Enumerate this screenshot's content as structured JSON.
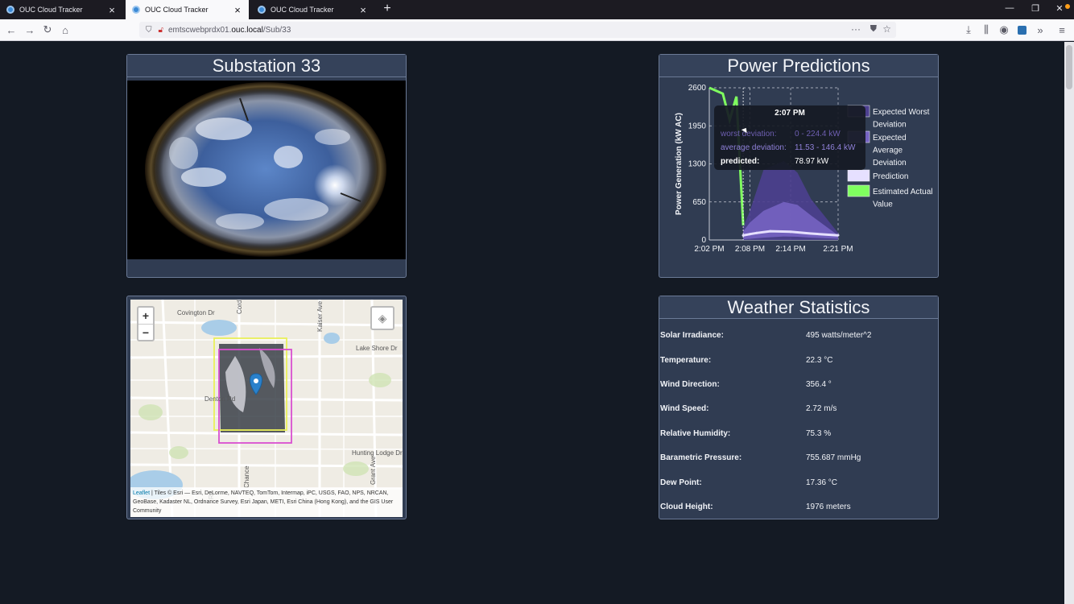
{
  "browser": {
    "tabs": [
      {
        "label": "OUC Cloud Tracker"
      },
      {
        "label": "OUC Cloud Tracker"
      },
      {
        "label": "OUC Cloud Tracker"
      }
    ],
    "url_prefix": "emtscwebprdx01.",
    "url_host": "ouc.local",
    "url_path": "/Sub/33"
  },
  "substation": {
    "title": "Substation 33"
  },
  "map": {
    "zoom_in": "+",
    "zoom_out": "−",
    "streets": [
      "Covington Dr",
      "Cord Ave",
      "Kaiser Ave",
      "Lake Shore Dr",
      "Denton Rd",
      "Hunting Lodge Dr",
      "Chance",
      "Grant Ave",
      "Rd"
    ],
    "attribution_leaflet": "Leaflet",
    "attribution_text": " | Tiles © Esri — Esri, DeLorme, NAVTEQ, TomTom, Intermap, iPC, USGS, FAO, NPS, NRCAN, GeoBase, Kadaster NL, Ordnance Survey, Esri Japan, METI, Esri China (Hong Kong), and the GIS User Community"
  },
  "power": {
    "title": "Power Predictions",
    "tooltip": {
      "time": "2:07 PM",
      "rows": [
        {
          "label": "worst deviation:",
          "value": "0 - 224.4 kW"
        },
        {
          "label": "average deviation:",
          "value": "11.53 - 146.4 kW"
        },
        {
          "label": "predicted:",
          "value": "78.97 kW"
        }
      ]
    },
    "legend": [
      {
        "label": "Expected Worst Deviation",
        "color": "#4c3f8f"
      },
      {
        "label": "Expected Average Deviation",
        "color": "#7563c2"
      },
      {
        "label": "Prediction",
        "color": "#e6e0ff"
      },
      {
        "label": "Estimated Actual Value",
        "color": "#7fff5f"
      }
    ]
  },
  "chart_data": {
    "type": "line",
    "title": "",
    "xlabel": "",
    "ylabel": "Power Generation (kW AC)",
    "ylim": [
      0,
      2600
    ],
    "y_ticks": [
      "0",
      "650",
      "1300",
      "1950",
      "2600"
    ],
    "x_ticks": [
      "2:02 PM",
      "2:08 PM",
      "2:14 PM",
      "2:21 PM"
    ],
    "x_range": [
      "2:02 PM",
      "2:21 PM"
    ],
    "grid": true,
    "legend_position": "right",
    "series": [
      {
        "name": "Estimated Actual Value",
        "x": [
          "2:02 PM",
          "2:03 PM",
          "2:04 PM",
          "2:05 PM",
          "2:06 PM",
          "2:07 PM"
        ],
        "values": [
          2600,
          2550,
          2500,
          2050,
          2450,
          250
        ]
      },
      {
        "name": "Prediction",
        "x": [
          "2:07 PM",
          "2:08 PM",
          "2:09 PM",
          "2:11 PM",
          "2:14 PM",
          "2:17 PM",
          "2:21 PM"
        ],
        "values": [
          79,
          100,
          120,
          150,
          140,
          110,
          80
        ]
      },
      {
        "name": "Expected Average Deviation",
        "x": [
          "2:07 PM",
          "2:08 PM",
          "2:10 PM",
          "2:13 PM",
          "2:15 PM",
          "2:17 PM",
          "2:21 PM"
        ],
        "low": [
          12,
          20,
          40,
          60,
          55,
          40,
          20
        ],
        "high": [
          146,
          300,
          500,
          650,
          600,
          420,
          80
        ]
      },
      {
        "name": "Expected Worst Deviation",
        "x": [
          "2:07 PM",
          "2:08 PM",
          "2:10 PM",
          "2:13 PM",
          "2:15 PM",
          "2:17 PM",
          "2:21 PM"
        ],
        "low": [
          0,
          0,
          0,
          0,
          0,
          0,
          0
        ],
        "high": [
          224,
          500,
          1200,
          1350,
          1150,
          700,
          120
        ]
      }
    ]
  },
  "weather": {
    "title": "Weather Statistics",
    "rows": [
      {
        "label": "Solar Irradiance:",
        "value": "495 watts/meter^2"
      },
      {
        "label": "Temperature:",
        "value": "22.3 °C"
      },
      {
        "label": "Wind Direction:",
        "value": "356.4 °"
      },
      {
        "label": "Wind Speed:",
        "value": "2.72 m/s"
      },
      {
        "label": "Relative Humidity:",
        "value": "75.3 %"
      },
      {
        "label": "Barametric Pressure:",
        "value": "755.687 mmHg"
      },
      {
        "label": "Dew Point:",
        "value": "17.36 °C"
      },
      {
        "label": "Cloud Height:",
        "value": "1976 meters"
      }
    ]
  }
}
